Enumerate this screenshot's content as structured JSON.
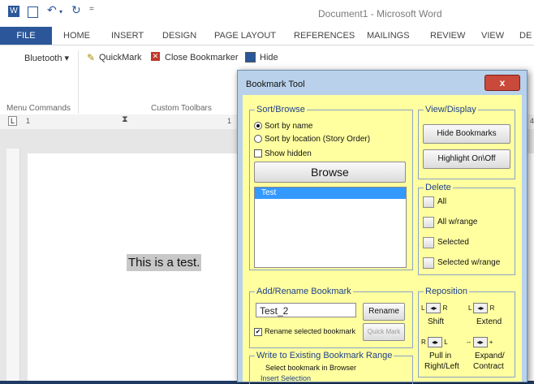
{
  "window": {
    "title": "Document1 - Microsoft Word"
  },
  "quick_access": {
    "word_icon": "W",
    "save_icon": "save-icon",
    "undo_icon": "↶",
    "redo_icon": "↻",
    "customize_icon": "="
  },
  "ribbon_tabs": [
    "FILE",
    "HOME",
    "INSERT",
    "DESIGN",
    "PAGE LAYOUT",
    "REFERENCES",
    "MAILINGS",
    "REVIEW",
    "VIEW",
    "DE"
  ],
  "ribbon": {
    "bluetooth_label": "Bluetooth",
    "quickmark_label": "QuickMark",
    "close_bookmarker_label": "Close Bookmarker",
    "hide_label": "Hide",
    "group_menu_commands": "Menu Commands",
    "group_custom_toolbars": "Custom Toolbars"
  },
  "ruler": {
    "left_marker": "L",
    "n1": "1",
    "n2": "1",
    "n4": "4"
  },
  "document": {
    "text": "This is a test."
  },
  "dialog": {
    "title": "Bookmark Tool",
    "close_label": "x",
    "sort_browse": {
      "legend": "Sort/Browse",
      "sort_by_name": "Sort by name",
      "sort_by_location": "Sort by location (Story Order)",
      "show_hidden": "Show hidden",
      "browse_label": "Browse",
      "list_items": [
        "Test"
      ]
    },
    "view_display": {
      "legend": "View/Display",
      "hide_bookmarks": "Hide Bookmarks",
      "highlight_toggle": "Highlight On\\Off"
    },
    "delete": {
      "legend": "Delete",
      "all": "All",
      "all_w_range": "All w/range",
      "selected": "Selected",
      "selected_w_range": "Selected w/range"
    },
    "add_rename": {
      "legend": "Add/Rename Bookmark",
      "name_value": "Test_2",
      "rename_label": "Rename",
      "rename_selected": "Rename selected bookmark",
      "quick_mark_label": "Quick Mark"
    },
    "reposition": {
      "legend": "Reposition",
      "shift_label": "Shift",
      "extend_label": "Extend",
      "pull_in_label": "Pull in",
      "right_left_label": "Right/Left",
      "expand_label": "Expand/",
      "contract_label": "Contract",
      "l": "L",
      "r": "R",
      "minus": "--",
      "plus": "+"
    },
    "write_existing": {
      "legend": "Write to Existing Bookmark Range",
      "select_hint": "Select bookmark in Browser",
      "insert_selection": "Insert Selection"
    }
  }
}
